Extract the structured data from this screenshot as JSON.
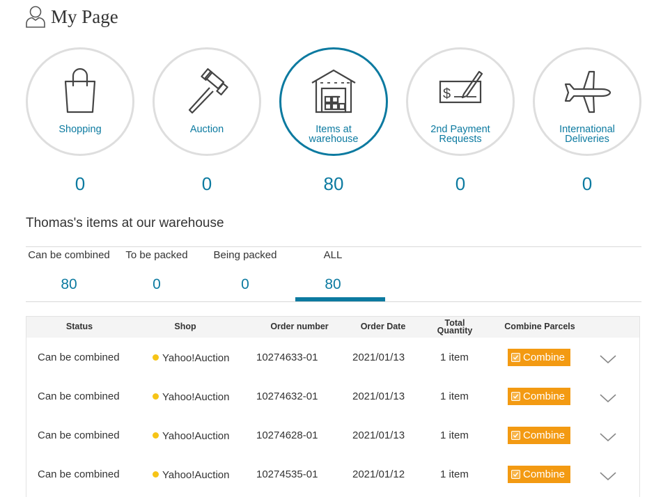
{
  "page": {
    "title": "My Page"
  },
  "categories": [
    {
      "label_lines": [
        "Shopping"
      ],
      "count": "0",
      "icon": "shopping-bag-icon"
    },
    {
      "label_lines": [
        "Auction"
      ],
      "count": "0",
      "icon": "gavel-icon"
    },
    {
      "label_lines": [
        "Items at",
        "warehouse"
      ],
      "count": "80",
      "icon": "warehouse-icon",
      "active": true
    },
    {
      "label_lines": [
        "2nd Payment",
        "Requests"
      ],
      "count": "0",
      "icon": "check-payment-icon"
    },
    {
      "label_lines": [
        "International",
        "Deliveries"
      ],
      "count": "0",
      "icon": "airplane-icon"
    }
  ],
  "section": {
    "title": "Thomas's items at our warehouse"
  },
  "tabs": [
    {
      "label": "Can be combined",
      "count": "80"
    },
    {
      "label": "To be packed",
      "count": "0"
    },
    {
      "label": "Being packed",
      "count": "0"
    },
    {
      "label": "ALL",
      "count": "80",
      "active": true
    }
  ],
  "table": {
    "headers": {
      "status": "Status",
      "shop": "Shop",
      "order_number": "Order number",
      "order_date": "Order Date",
      "total_quantity_1": "Total",
      "total_quantity_2": "Quantity",
      "combine_parcels": "Combine Parcels"
    },
    "rows": [
      {
        "status": "Can be combined",
        "shop": "Yahoo!Auction",
        "order_number": "10274633-01",
        "order_date": "2021/01/13",
        "quantity": "1 item",
        "action": "Combine"
      },
      {
        "status": "Can be combined",
        "shop": "Yahoo!Auction",
        "order_number": "10274632-01",
        "order_date": "2021/01/13",
        "quantity": "1 item",
        "action": "Combine"
      },
      {
        "status": "Can be combined",
        "shop": "Yahoo!Auction",
        "order_number": "10274628-01",
        "order_date": "2021/01/13",
        "quantity": "1 item",
        "action": "Combine"
      },
      {
        "status": "Can be combined",
        "shop": "Yahoo!Auction",
        "order_number": "10274535-01",
        "order_date": "2021/01/12",
        "quantity": "1 item",
        "action": "Combine"
      }
    ]
  },
  "colors": {
    "accent": "#0c7aa0",
    "combine_button": "#f39a12",
    "shop_dot": "#f6c417"
  }
}
